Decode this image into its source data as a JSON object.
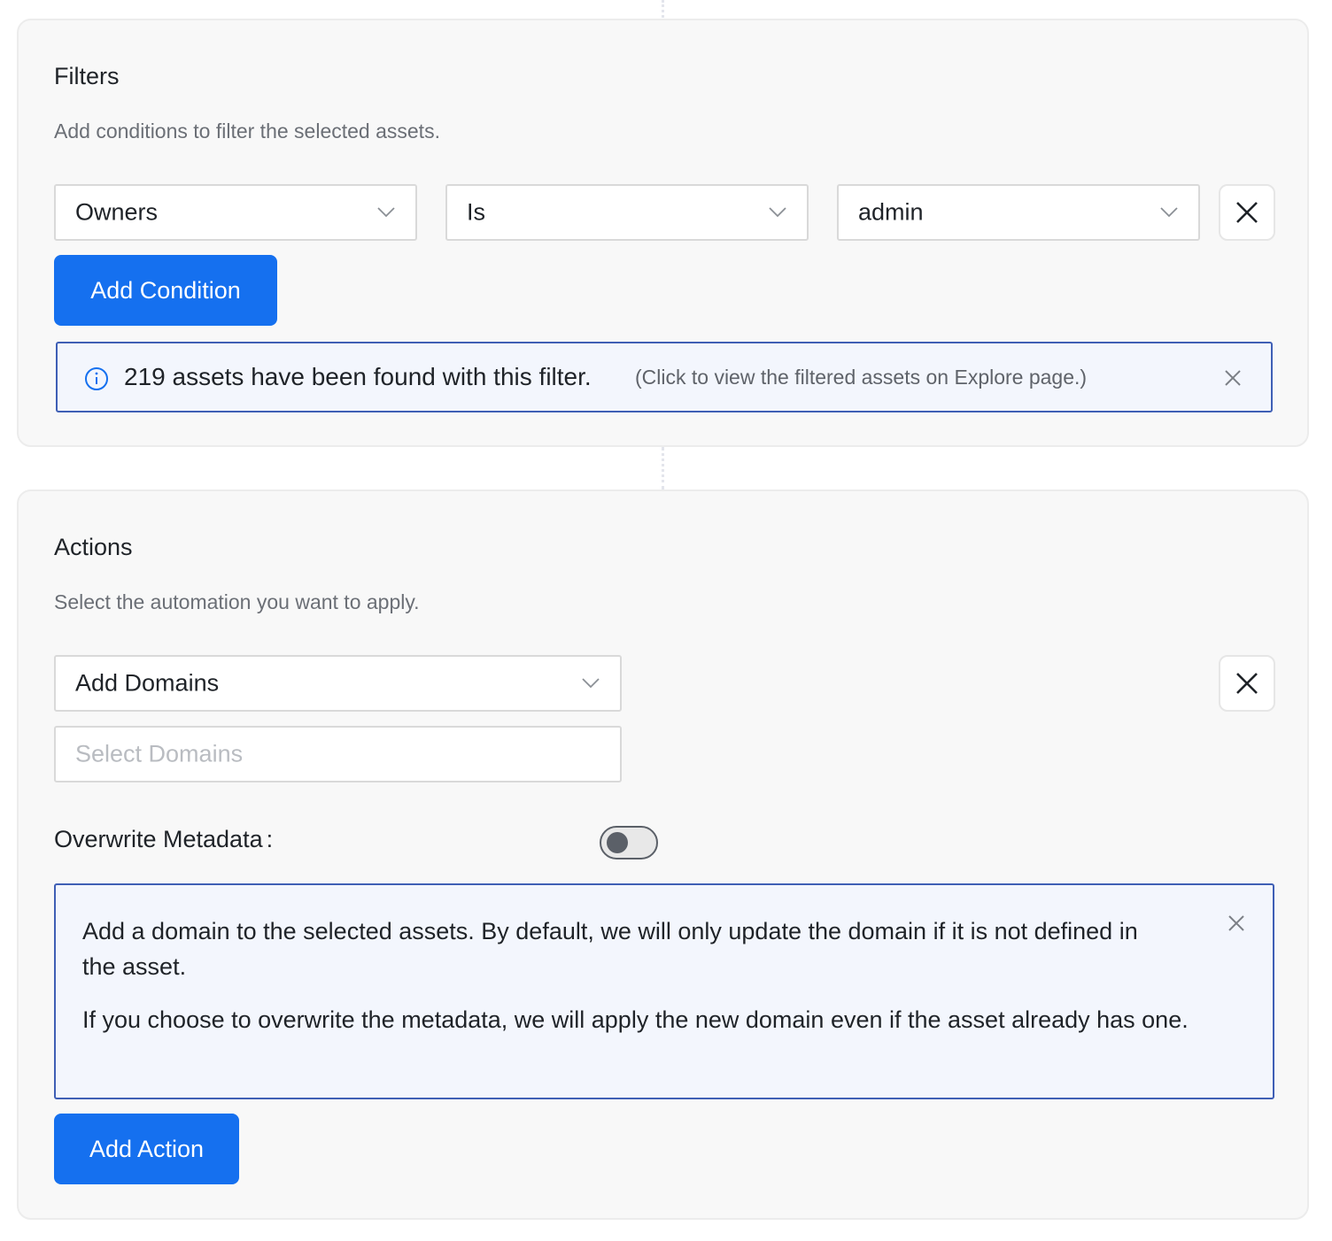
{
  "filters": {
    "title": "Filters",
    "subtitle": "Add conditions to filter the selected assets.",
    "condition": {
      "field": "Owners",
      "operator": "Is",
      "value": "admin"
    },
    "add_condition_label": "Add Condition",
    "result_banner": {
      "icon": "info-icon",
      "main_text": "219 assets have been found with this filter.",
      "hint_text": "(Click to view the filtered assets on Explore page.)"
    }
  },
  "actions": {
    "title": "Actions",
    "subtitle": "Select the automation you want to apply.",
    "action_type": "Add Domains",
    "domains_placeholder": "Select Domains",
    "overwrite_label": "Overwrite Metadata",
    "overwrite_colon": ":",
    "overwrite_enabled": false,
    "info": {
      "paragraph1": "Add a domain to the selected assets. By default, we will only update the domain if it is not defined in the asset.",
      "paragraph2": "If you choose to overwrite the metadata, we will apply the new domain even if the asset already has one."
    },
    "add_action_label": "Add Action"
  },
  "colors": {
    "primary": "#1570ef",
    "info_border": "#3f5fb5",
    "info_bg": "#f3f6fd"
  }
}
